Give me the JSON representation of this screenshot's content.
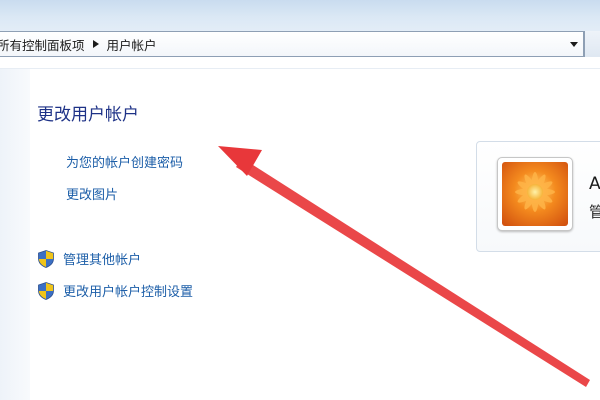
{
  "breadcrumb": {
    "first": "所有控制面板项",
    "second": "用户帐户"
  },
  "page": {
    "title": "更改用户帐户"
  },
  "links": {
    "create_password": "为您的帐户创建密码",
    "change_picture": "更改图片",
    "manage_other": "管理其他帐户",
    "uac_settings": "更改用户帐户控制设置"
  },
  "account": {
    "name_partial": "A",
    "role_partial": "管"
  },
  "icons": {
    "breadcrumb_separator": "chevron-right-icon",
    "dropdown": "chevron-down-icon",
    "shield": "uac-shield-icon",
    "avatar": "flower-avatar-icon",
    "annotation": "red-arrow-annotation"
  },
  "colors": {
    "title": "#1e3287",
    "link": "#1c5ea8",
    "annotation_arrow": "#e8373a"
  }
}
